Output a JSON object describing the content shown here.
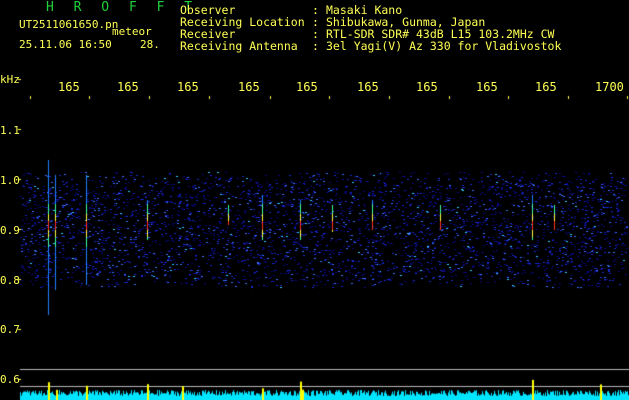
{
  "header": {
    "logo": "H R O F F T",
    "filename": "UT2511061650.pn",
    "meteor_label": "meteor",
    "datetime": "25.11.06 16:50",
    "count": "28."
  },
  "info": [
    {
      "key": "Observer",
      "value": "Masaki Kano"
    },
    {
      "key": "Receiving Location",
      "value": "Shibukawa, Gunma, Japan"
    },
    {
      "key": "Receiver",
      "value": "RTL-SDR SDR# 43dB L15 103.2MHz CW"
    },
    {
      "key": "Receiving Antenna",
      "value": "3el Yagi(V) Az 330 for Vladivostok"
    }
  ],
  "axis": {
    "unit": "kHz",
    "x_ticks": [
      "165",
      "165",
      "165",
      "165",
      "165",
      "165",
      "165",
      "165",
      "165",
      "1700"
    ],
    "y_ticks": [
      "1.1",
      "1.0",
      "0.9",
      "0.8",
      "0.7",
      "0.6"
    ]
  },
  "colors": {
    "text": "#ffff55",
    "logo": "#1fd13a",
    "noise_dark": "#0a0a80",
    "noise_light": "#3050ff",
    "spectrum": "#00e5ff",
    "spike": "#ffff00"
  }
}
